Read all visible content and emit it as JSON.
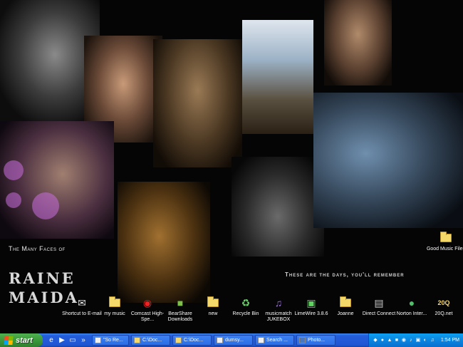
{
  "wallpaper": {
    "caption": "The Many Faces of",
    "name_line1": "RAINE",
    "name_line2": "MAIDA",
    "tagline": "These are the days, you'll remember"
  },
  "desktop_icons": [
    {
      "id": "good-music-files",
      "label": "Good Music Files",
      "icon": "folder-icon"
    },
    {
      "id": "shortcut-email",
      "label": "Shortcut to E-mail",
      "icon": "email-icon"
    },
    {
      "id": "my-music",
      "label": "my music",
      "icon": "folder-icon"
    },
    {
      "id": "comcast",
      "label": "Comcast High-Spe...",
      "icon": "comcast-icon"
    },
    {
      "id": "bearshare",
      "label": "BearShare Downloads",
      "icon": "bearshare-icon"
    },
    {
      "id": "new",
      "label": "new",
      "icon": "folder-icon"
    },
    {
      "id": "recycle-bin",
      "label": "Recycle Bin",
      "icon": "recycle-bin-icon"
    },
    {
      "id": "musicmatch",
      "label": "musicmatch JUKEBOX",
      "icon": "musicmatch-icon"
    },
    {
      "id": "limewire",
      "label": "LimeWire 3.8.6",
      "icon": "limewire-icon"
    },
    {
      "id": "joanne",
      "label": "Joanne",
      "icon": "folder-icon"
    },
    {
      "id": "direct-connect",
      "label": "Direct Connect",
      "icon": "direct-connect-icon"
    },
    {
      "id": "norton",
      "label": "Norton Inter...",
      "icon": "norton-icon"
    },
    {
      "id": "20q",
      "label": "20Q.net",
      "icon": "20q-icon"
    }
  ],
  "taskbar": {
    "start_label": "start",
    "buttons": [
      {
        "label": "\"So Re...",
        "icon": "ie-icon"
      },
      {
        "label": "C:\\Doc...",
        "icon": "folder-icon"
      },
      {
        "label": "C:\\Doc...",
        "icon": "folder-icon"
      },
      {
        "label": "dumsy...",
        "icon": "document-icon"
      },
      {
        "label": "Search ...",
        "icon": "search-icon"
      },
      {
        "label": "Photo...",
        "icon": "photoshop-icon"
      }
    ],
    "clock": "1:54 PM"
  }
}
